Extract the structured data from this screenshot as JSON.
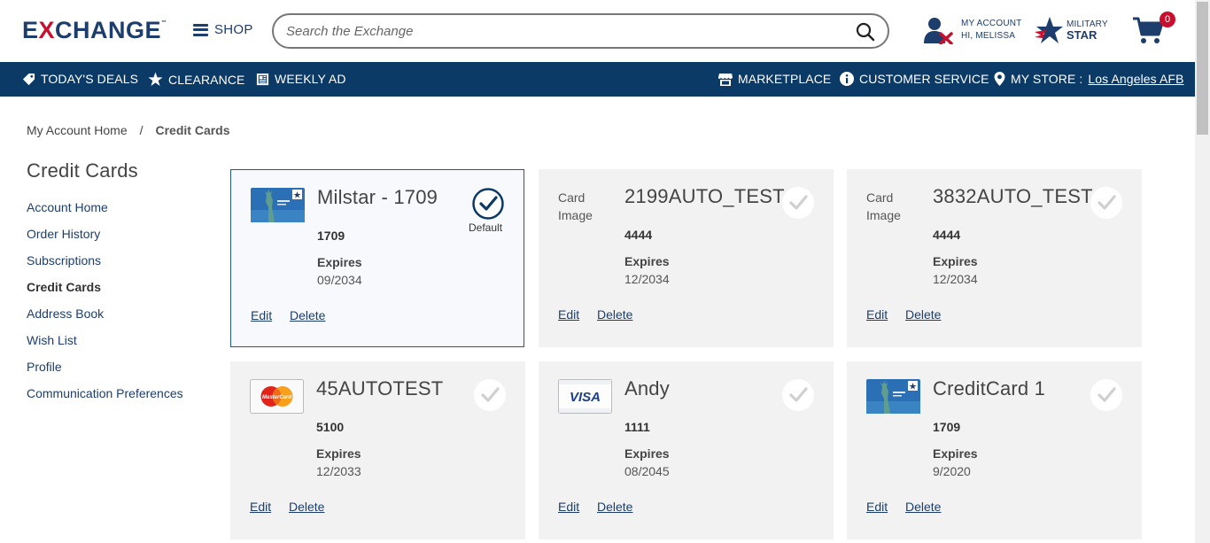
{
  "header": {
    "logo": {
      "pre": "E",
      "x": "X",
      "post": "CHANGE",
      "tm": "™"
    },
    "shop_label": "SHOP",
    "search_placeholder": "Search the Exchange",
    "account_line1": "MY ACCOUNT",
    "account_line2": "HI, MELISSA",
    "star_line1": "MILITARY",
    "star_line2": "STAR",
    "cart_count": "0"
  },
  "nav": {
    "left": [
      {
        "label": "TODAY'S DEALS",
        "icon": "tag-icon"
      },
      {
        "label": "CLEARANCE",
        "icon": "star-icon"
      },
      {
        "label": "WEEKLY AD",
        "icon": "newspaper-icon"
      }
    ],
    "right": [
      {
        "label": "MARKETPLACE",
        "icon": "store-icon"
      },
      {
        "label": "CUSTOMER SERVICE",
        "icon": "info-icon"
      },
      {
        "label": "MY STORE :",
        "icon": "location-icon",
        "store": "Los Angeles AFB"
      }
    ]
  },
  "breadcrumb": {
    "home": "My Account Home",
    "sep": "/",
    "current": "Credit Cards"
  },
  "sidebar": {
    "title": "Credit Cards",
    "items": [
      {
        "label": "Account Home"
      },
      {
        "label": "Order History"
      },
      {
        "label": "Subscriptions"
      },
      {
        "label": "Credit Cards",
        "active": true
      },
      {
        "label": "Address Book"
      },
      {
        "label": "Wish List"
      },
      {
        "label": "Profile"
      },
      {
        "label": "Communication Preferences"
      }
    ]
  },
  "cards": [
    {
      "name": "Milstar - 1709",
      "number": "1709",
      "expires_label": "Expires",
      "expires": "09/2034",
      "image": "milstar-card",
      "default": true,
      "default_label": "Default",
      "edit": "Edit",
      "delete": "Delete"
    },
    {
      "name": "2199AUTO_TEST",
      "number": "4444",
      "expires_label": "Expires",
      "expires": "12/2034",
      "image": "broken",
      "broken_text": "Card Image",
      "default": false,
      "edit": "Edit",
      "delete": "Delete"
    },
    {
      "name": "3832AUTO_TEST",
      "number": "4444",
      "expires_label": "Expires",
      "expires": "12/2034",
      "image": "broken",
      "broken_text": "Card Image",
      "default": false,
      "edit": "Edit",
      "delete": "Delete"
    },
    {
      "name": "45AUTOTEST",
      "number": "5100",
      "expires_label": "Expires",
      "expires": "12/2033",
      "image": "mastercard",
      "brand_text": "MasterCard",
      "default": false,
      "edit": "Edit",
      "delete": "Delete"
    },
    {
      "name": "Andy",
      "number": "1111",
      "expires_label": "Expires",
      "expires": "08/2045",
      "image": "visa",
      "brand_text": "VISA",
      "default": false,
      "edit": "Edit",
      "delete": "Delete"
    },
    {
      "name": "CreditCard 1",
      "number": "1709",
      "expires_label": "Expires",
      "expires": "9/2020",
      "image": "milstar-card",
      "default": false,
      "edit": "Edit",
      "delete": "Delete"
    }
  ],
  "colors": {
    "brand_navy": "#1d3e6c",
    "nav_bg": "#0b3a66",
    "brand_red": "#c8102e",
    "card_bg": "#f2f2f2"
  }
}
